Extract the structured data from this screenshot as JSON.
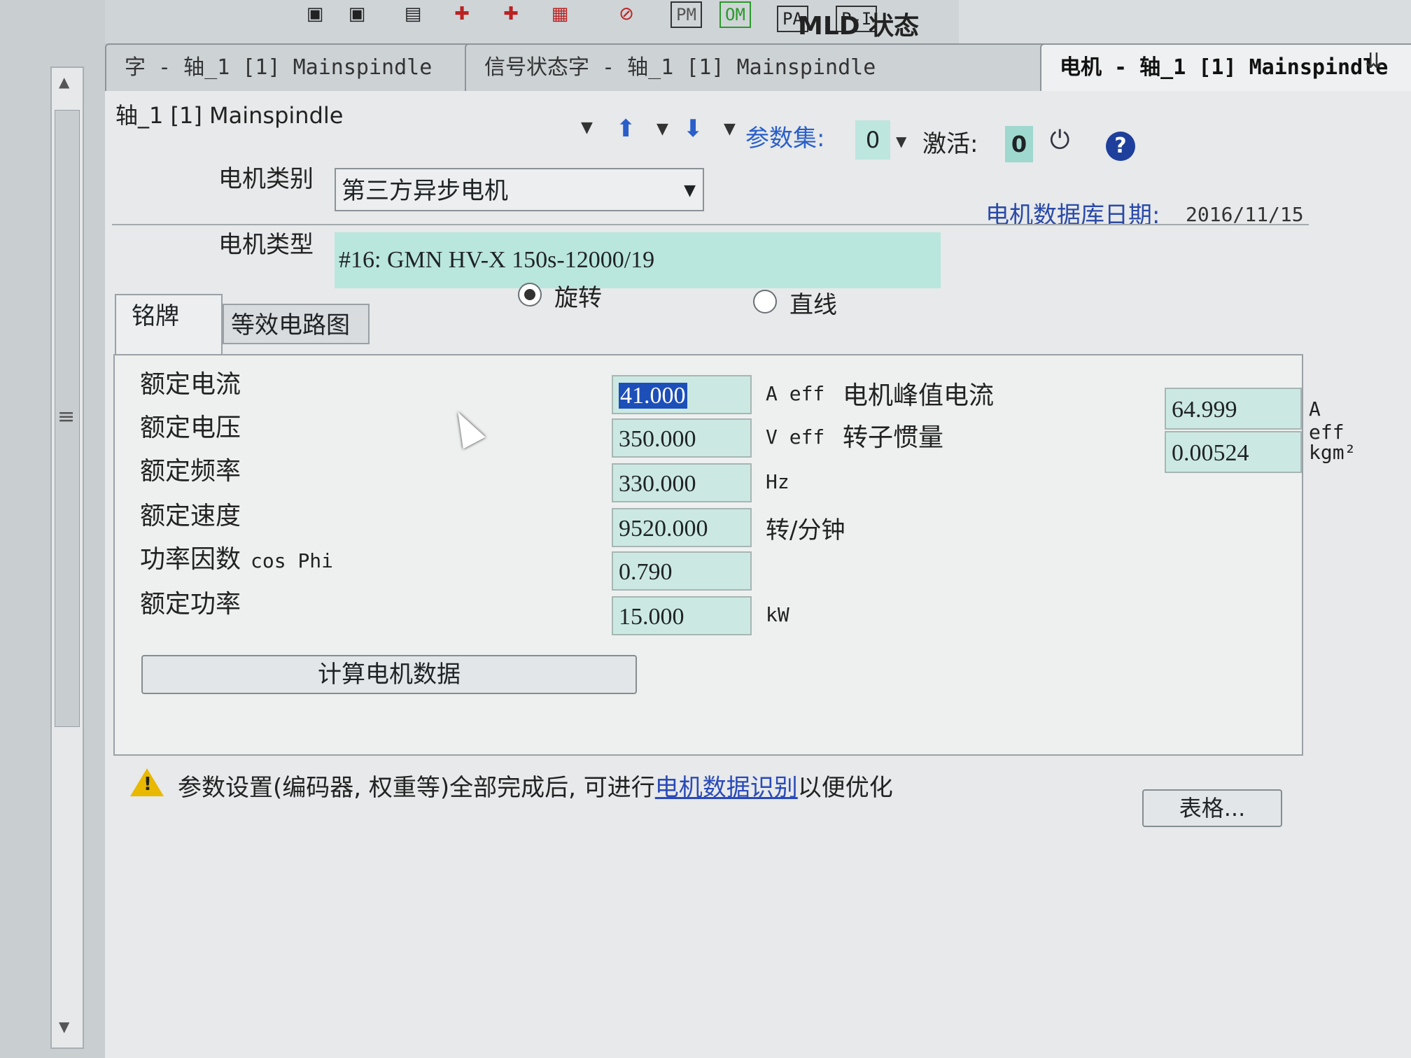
{
  "toolbar": {
    "pm": "PM",
    "om": "OM",
    "pa": "PA",
    "pd": "P-I",
    "mld": "MLD 状态"
  },
  "tabs": [
    {
      "label": "字 - 轴_1 [1] Mainspindle"
    },
    {
      "label": "信号状态字 - 轴_1 [1] Mainspindle"
    },
    {
      "label": "电机 - 轴_1 [1] Mainspindle"
    }
  ],
  "header": {
    "axis_title": "轴_1 [1] Mainspindle",
    "param_set_label": "参数集:",
    "param_set_value": "0",
    "active_label": "激活:",
    "active_value": "0"
  },
  "motor": {
    "class_label": "电机类别",
    "class_value": "第三方异步电机",
    "db_date_label": "电机数据库日期:",
    "db_date_value": "2016/11/15",
    "type_label": "电机类型",
    "type_value": "#16: GMN HV-X 150s-12000/19",
    "radio_rotary": "旋转",
    "radio_linear": "直线"
  },
  "subtabs": {
    "nameplate": "铭牌",
    "equiv_circuit": "等效电路图"
  },
  "nameplate": {
    "rated_current_label": "额定电流",
    "rated_current_value": "41.000",
    "rated_current_unit": "A eff",
    "rated_voltage_label": "额定电压",
    "rated_voltage_value": "350.000",
    "rated_voltage_unit": "V eff",
    "rated_freq_label": "额定频率",
    "rated_freq_value": "330.000",
    "rated_freq_unit": "Hz",
    "rated_speed_label": "额定速度",
    "rated_speed_value": "9520.000",
    "rated_speed_unit": "转/分钟",
    "pf_label": "功率因数",
    "pf_sub": "cos Phi",
    "pf_value": "0.790",
    "rated_power_label": "额定功率",
    "rated_power_value": "15.000",
    "rated_power_unit": "kW",
    "peak_current_label": "电机峰值电流",
    "peak_current_value": "64.999",
    "peak_current_unit": "A eff",
    "inertia_label": "转子惯量",
    "inertia_value": "0.00524",
    "inertia_unit": "kgm²",
    "calc_button": "计算电机数据"
  },
  "footer": {
    "warn_pre": "参数设置(编码器, 权重等)全部完成后, 可进行",
    "warn_link": "电机数据识别",
    "warn_post": "以便优化",
    "table_button": "表格..."
  }
}
